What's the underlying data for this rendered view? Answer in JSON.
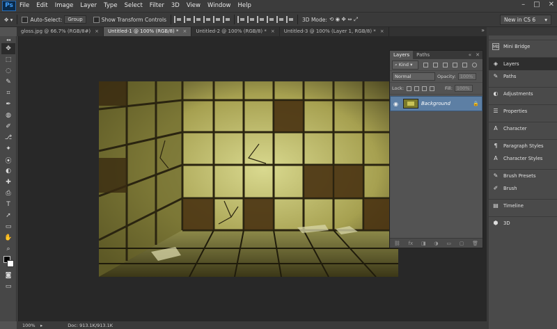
{
  "app": {
    "logo": "Ps"
  },
  "menu": [
    "File",
    "Edit",
    "Image",
    "Layer",
    "Type",
    "Select",
    "Filter",
    "3D",
    "View",
    "Window",
    "Help"
  ],
  "window_controls": [
    "–",
    "□",
    "✕"
  ],
  "options": {
    "auto_select_label": "Auto-Select:",
    "auto_select_value": "Group",
    "transform_label": "Show Transform Controls",
    "mode_label": "3D Mode:",
    "workspace": "New in CS 6"
  },
  "tabs": [
    {
      "label": "gloss.jpg @ 66.7% (RGB/8#)"
    },
    {
      "label": "Untitled-1 @ 100% (RGB/8) *"
    },
    {
      "label": "Untitled-2 @ 100% (RGB/8) *"
    },
    {
      "label": "Untitled-3 @ 100% (Layer 1, RGB/8) *"
    }
  ],
  "tools": [
    "✥",
    "⬚",
    "◌",
    "✎",
    "⌗",
    "✒",
    "◍",
    "✐",
    "⎇",
    "✦",
    "⦿",
    "◐",
    "✚",
    "⎙",
    "T",
    "➚",
    "▭",
    "✋",
    "⌕"
  ],
  "layers_panel": {
    "tabs": [
      "Layers",
      "Paths"
    ],
    "kind_label": "Kind",
    "blend_mode": "Normal",
    "opacity_label": "Opacity:",
    "opacity_value": "100%",
    "lock_label": "Lock:",
    "fill_label": "Fill:",
    "fill_value": "100%",
    "layer_name": "Background",
    "bottom_icons": [
      "⛓",
      "fx",
      "◨",
      "◑",
      "▭",
      "▢",
      "🗑"
    ]
  },
  "dock": {
    "items": [
      {
        "label": "Mini Bridge",
        "icon": "Mb"
      },
      {
        "label": "Layers",
        "icon": "◈"
      },
      {
        "label": "Paths",
        "icon": "✎"
      },
      {
        "label": "Adjustments",
        "icon": "◐"
      },
      {
        "label": "Properties",
        "icon": "☰"
      },
      {
        "label": "Character",
        "icon": "A"
      },
      {
        "label": "Paragraph Styles",
        "icon": "¶"
      },
      {
        "label": "Character Styles",
        "icon": "A"
      },
      {
        "label": "Brush Presets",
        "icon": "✎"
      },
      {
        "label": "Brush",
        "icon": "✐"
      },
      {
        "label": "Timeline",
        "icon": "▤"
      },
      {
        "label": "3D",
        "icon": "⬢"
      }
    ]
  },
  "status": {
    "zoom": "100%",
    "doc_info": "Doc: 913.1K/913.1K"
  }
}
